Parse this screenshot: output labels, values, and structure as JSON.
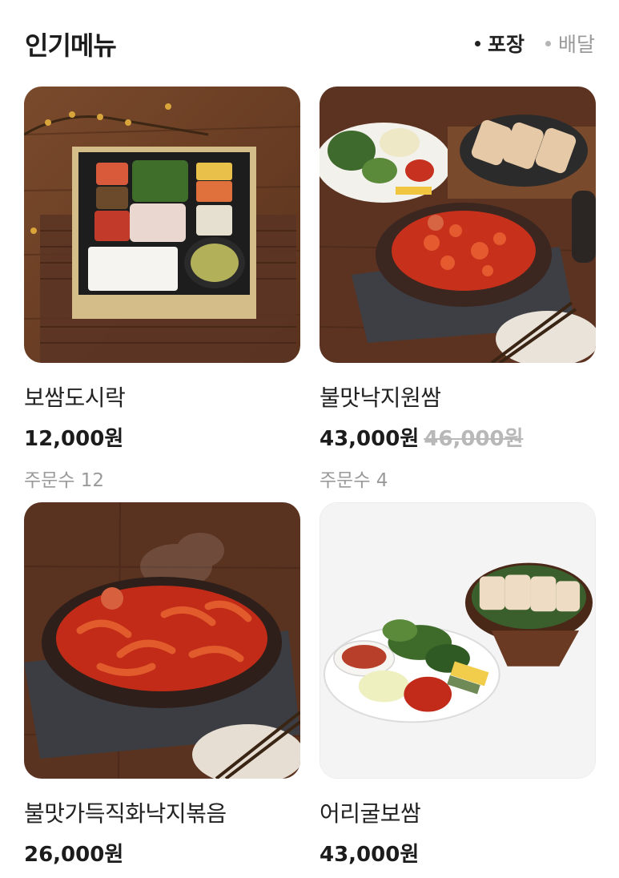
{
  "section": {
    "title": "인기메뉴"
  },
  "filters": [
    {
      "label": "포장",
      "active": true
    },
    {
      "label": "배달",
      "active": false
    }
  ],
  "menu": [
    {
      "name": "보쌈도시락",
      "price": "12,000원",
      "original_price": "",
      "orders": "주문수 12"
    },
    {
      "name": "불맛낙지원쌈",
      "price": "43,000원",
      "original_price": "46,000원",
      "orders": "주문수 4"
    },
    {
      "name": "불맛가득직화낙지볶음",
      "price": "26,000원",
      "original_price": "",
      "orders": ""
    },
    {
      "name": "어리굴보쌈",
      "price": "43,000원",
      "original_price": "",
      "orders": ""
    }
  ]
}
